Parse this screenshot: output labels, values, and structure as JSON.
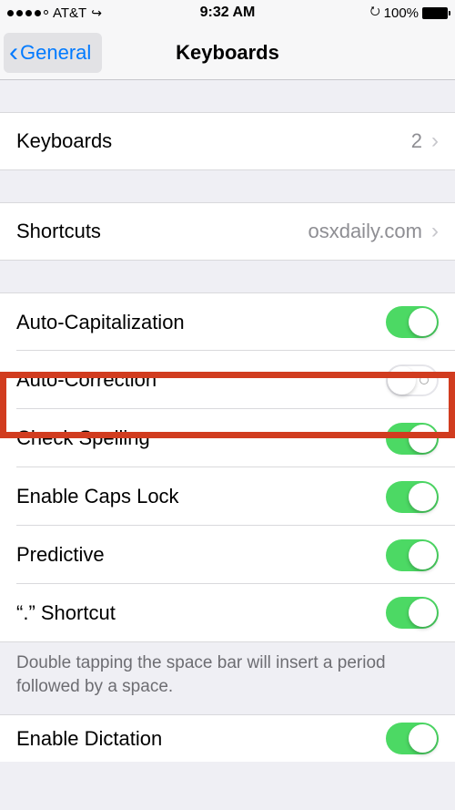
{
  "statusBar": {
    "carrier": "AT&T",
    "time": "9:32 AM",
    "batteryPct": "100%"
  },
  "nav": {
    "backLabel": "General",
    "title": "Keyboards"
  },
  "rows": {
    "keyboards": {
      "label": "Keyboards",
      "value": "2"
    },
    "shortcuts": {
      "label": "Shortcuts",
      "value": "osxdaily.com"
    }
  },
  "toggles": {
    "autoCap": {
      "label": "Auto-Capitalization"
    },
    "autoCorrect": {
      "label": "Auto-Correction"
    },
    "checkSpelling": {
      "label": "Check Spelling"
    },
    "capsLock": {
      "label": "Enable Caps Lock"
    },
    "predictive": {
      "label": "Predictive"
    },
    "periodShortcut": {
      "label": "“.” Shortcut"
    },
    "enableDictation": {
      "label": "Enable Dictation"
    }
  },
  "footer": "Double tapping the space bar will insert a period followed by a space."
}
